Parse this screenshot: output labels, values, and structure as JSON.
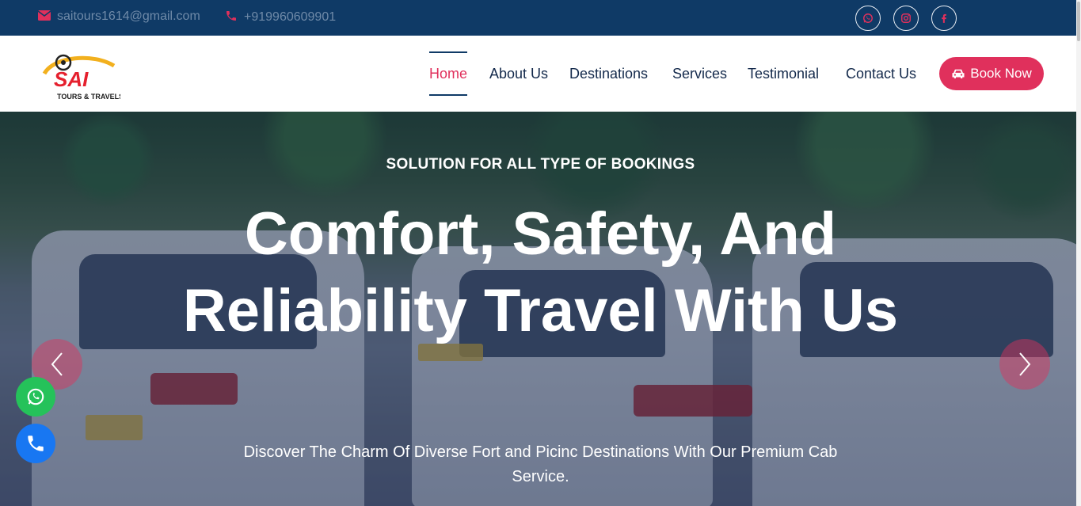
{
  "topbar": {
    "email": "saitours1614@gmail.com",
    "phone": "+919960609901",
    "email_icon": "envelope-icon",
    "phone_icon": "phone-icon",
    "social": [
      "whatsapp-icon",
      "instagram-icon",
      "facebook-icon"
    ]
  },
  "nav": {
    "logo_text": "SAI",
    "logo_sub": "TOURS & TRAVELS",
    "links": [
      "Home",
      "About Us",
      "Destinations",
      "Services",
      "Testimonial",
      "Contact Us"
    ],
    "active": "Home",
    "book_label": "Book Now",
    "book_icon": "car-icon"
  },
  "hero": {
    "subtitle": "SOLUTION FOR ALL TYPE OF BOOKINGS",
    "title": "Comfort, Safety, And Reliability Travel With Us",
    "description": "Discover The Charm Of Diverse Fort and Picinc Destinations With Our Premium Cab Service."
  },
  "colors": {
    "topbar": "#0f3a66",
    "accent": "#e0305c",
    "nav_text": "#13294b",
    "whatsapp": "#25c25a",
    "call": "#1877f2"
  }
}
